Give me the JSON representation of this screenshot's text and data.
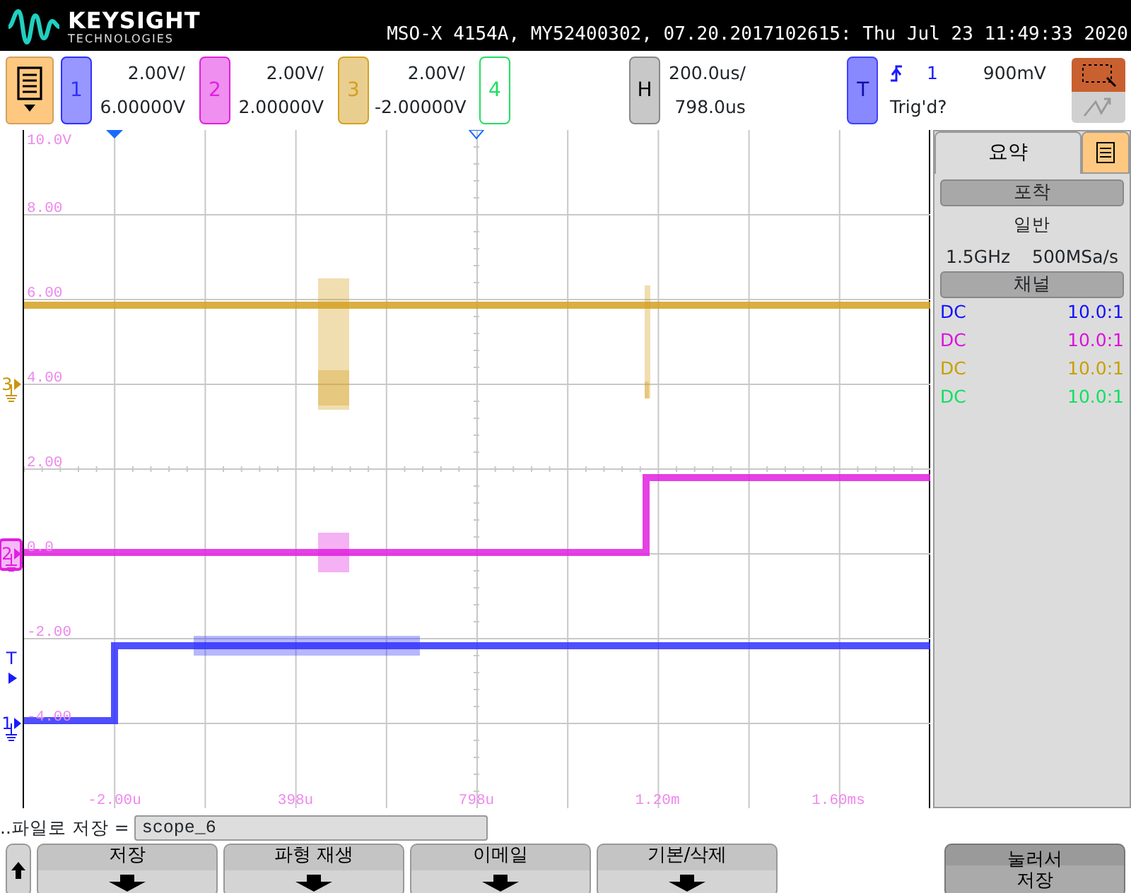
{
  "header": {
    "brand": "KEYSIGHT",
    "brand_sub": "TECHNOLOGIES",
    "title": "MSO-X 4154A, MY52400302, 07.20.2017102615: Thu Jul 23 11:49:33 2020"
  },
  "channels": [
    {
      "number": "1",
      "scale": "2.00V/",
      "offset": "6.00000V",
      "color": "#3030ff",
      "on": true
    },
    {
      "number": "2",
      "scale": "2.00V/",
      "offset": "2.00000V",
      "color": "#e020e0",
      "on": true
    },
    {
      "number": "3",
      "scale": "2.00V/",
      "offset": "-2.00000V",
      "color": "#d4a020",
      "on": true
    },
    {
      "number": "4",
      "color": "#20e060",
      "on": false
    }
  ],
  "horizontal": {
    "label": "H",
    "scale": "200.0us/",
    "delay": "798.0us"
  },
  "trigger": {
    "label": "T",
    "source": "1",
    "threshold": "900mV",
    "status": "Trig'd?"
  },
  "y_labels": [
    "10.0V",
    "8.00",
    "6.00",
    "4.00",
    "2.00",
    "0.0",
    "-2.00",
    "-4.00"
  ],
  "x_labels": [
    "-2.00u",
    "398u",
    "798u",
    "1.20m",
    "1.60ms"
  ],
  "left_markers": [
    {
      "label": "3",
      "kind": "ground",
      "color": "#c8960a"
    },
    {
      "label": "2",
      "kind": "boxed",
      "color": "#e020e0"
    },
    {
      "label": "T",
      "kind": "trigger",
      "color": "#1a1aff"
    },
    {
      "label": "1",
      "kind": "ground",
      "color": "#1a1aff"
    }
  ],
  "side_panel": {
    "tabs": [
      {
        "label": "요약",
        "kind": "text",
        "selected": true
      },
      {
        "kind": "menu",
        "selected": false
      }
    ],
    "acquisition": {
      "heading": "포착",
      "mode": "일반",
      "bandwidth": "1.5GHz",
      "rate": "500MSa/s"
    },
    "channel_heading": "채널",
    "channel_rows": [
      {
        "coupling": "DC",
        "ratio": "10.0:1",
        "color": "#1010ff"
      },
      {
        "coupling": "DC",
        "ratio": "10.0:1",
        "color": "#dd10dd"
      },
      {
        "coupling": "DC",
        "ratio": "10.0:1",
        "color": "#c8a000"
      },
      {
        "coupling": "DC",
        "ratio": "10.0:1",
        "color": "#10e060"
      }
    ]
  },
  "file": {
    "label": "..파일로 저장 =",
    "value": "scope_6"
  },
  "softkeys": [
    {
      "kind": "up"
    },
    {
      "kind": "menu",
      "lines": [
        "저장"
      ]
    },
    {
      "kind": "menu",
      "lines": [
        "파형 재생"
      ]
    },
    {
      "kind": "menu",
      "lines": [
        "이메일"
      ]
    },
    {
      "kind": "menu",
      "lines": [
        "기본/삭제"
      ]
    },
    {
      "kind": "push",
      "lines": [
        "눌러서",
        "저장"
      ]
    }
  ]
}
